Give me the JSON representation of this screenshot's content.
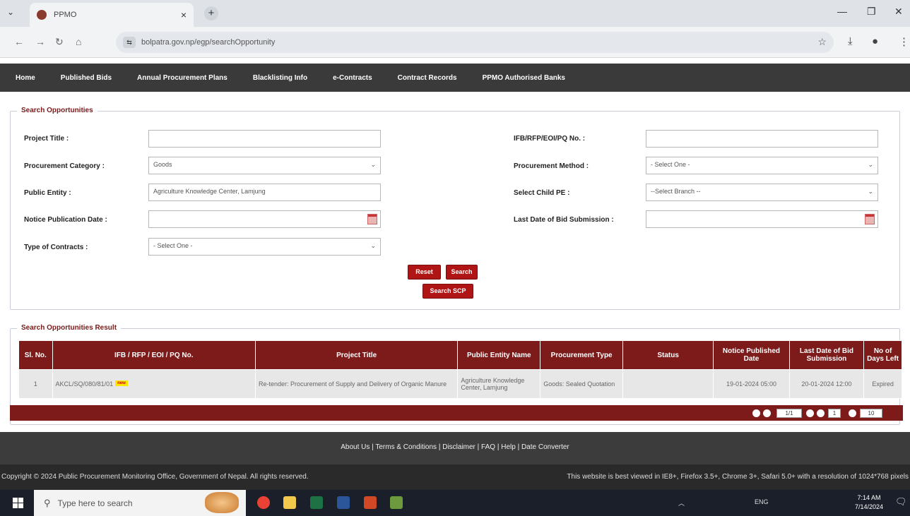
{
  "browser": {
    "tab_title": "PPMO",
    "url": "bolpatra.gov.np/egp/searchOpportunity"
  },
  "nav": [
    "Home",
    "Published Bids",
    "Annual Procurement Plans",
    "Blacklisting Info",
    "e-Contracts",
    "Contract Records",
    "PPMO Authorised Banks"
  ],
  "search": {
    "legend": "Search Opportunities",
    "project_title_label": "Project Title :",
    "project_title_value": "",
    "ifb_label": "IFB/RFP/EOI/PQ No. :",
    "ifb_value": "",
    "category_label": "Procurement Category :",
    "category_value": "Goods",
    "method_label": "Procurement Method :",
    "method_value": "- Select One -",
    "entity_label": "Public Entity :",
    "entity_value": "Agriculture Knowledge Center, Lamjung",
    "child_pe_label": "Select Child PE :",
    "child_pe_value": "--Select Branch --",
    "notice_date_label": "Notice Publication Date :",
    "notice_date_value": "",
    "last_date_label": "Last Date of Bid Submission :",
    "last_date_value": "",
    "contract_type_label": "Type of Contracts :",
    "contract_type_value": "- Select One -",
    "reset_label": "Reset",
    "search_label": "Search",
    "search_scp_label": "Search SCP"
  },
  "results": {
    "legend": "Search Opportunities Result",
    "headers": [
      "Sl. No.",
      "IFB / RFP / EOI / PQ No.",
      "Project Title",
      "Public Entity Name",
      "Procurement Type",
      "Status",
      "Notice Published Date",
      "Last Date of Bid Submission",
      "No of Days Left"
    ],
    "rows": [
      {
        "sl": "1",
        "ifb": "AKCL/SQ/080/81/01",
        "badge": "new",
        "title": "Re-tender: Procurement of Supply and Delivery of Organic Manure",
        "entity": "Agriculture Knowledge Center, Lamjung",
        "type": "Goods: Sealed Quotation",
        "status": "",
        "published": "19-01-2024 05:00",
        "last_date": "20-01-2024 12:00",
        "days_left": "Expired"
      }
    ],
    "pager": {
      "page": "1/1",
      "goto": "1",
      "per_page": "10"
    }
  },
  "footer": {
    "links": [
      "About Us",
      "Terms & Conditions",
      "Disclaimer",
      "FAQ",
      "Help",
      "Date Converter"
    ],
    "copyright": "Copyright © 2024 Public Procurement Monitoring Office, Government of Nepal. All rights reserved.",
    "browser_note": "This website is best viewed in IE8+, Firefox 3.5+, Chrome 3+, Safari 5.0+ with a resolution of 1024*768 pixels"
  },
  "taskbar": {
    "search_placeholder": "Type here to search",
    "lang": "ENG",
    "time": "7:14 AM",
    "date": "7/14/2024"
  },
  "colors": {
    "nav_bg": "#3a3a3a",
    "header_maroon": "#7d1a1a",
    "button_red": "#b01515",
    "footer_bg": "#3c3c3c"
  }
}
